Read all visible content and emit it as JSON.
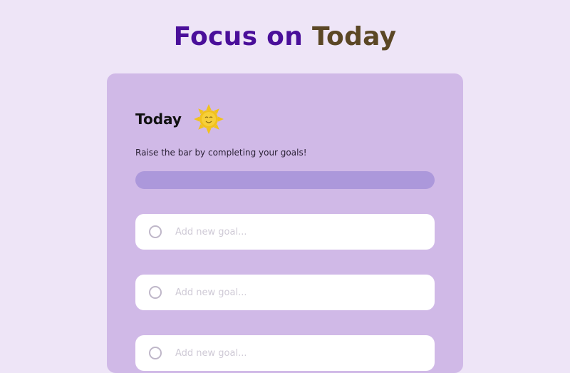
{
  "header": {
    "title_part1": "Focus on",
    "title_part2": "Today"
  },
  "card": {
    "title": "Today",
    "title_icon": "sun-icon",
    "subtitle": "Raise the bar by completing your goals!",
    "progress": 0
  },
  "goals": [
    {
      "placeholder": "Add new goal...",
      "value": "",
      "completed": false
    },
    {
      "placeholder": "Add new goal...",
      "value": "",
      "completed": false
    },
    {
      "placeholder": "Add new goal...",
      "value": "",
      "completed": false
    }
  ],
  "colors": {
    "background": "#eee5f7",
    "card": "#d0b9e7",
    "title_accent_1": "#4a0f9a",
    "title_accent_2": "#5b4725",
    "progress_track": "#ac98db"
  }
}
